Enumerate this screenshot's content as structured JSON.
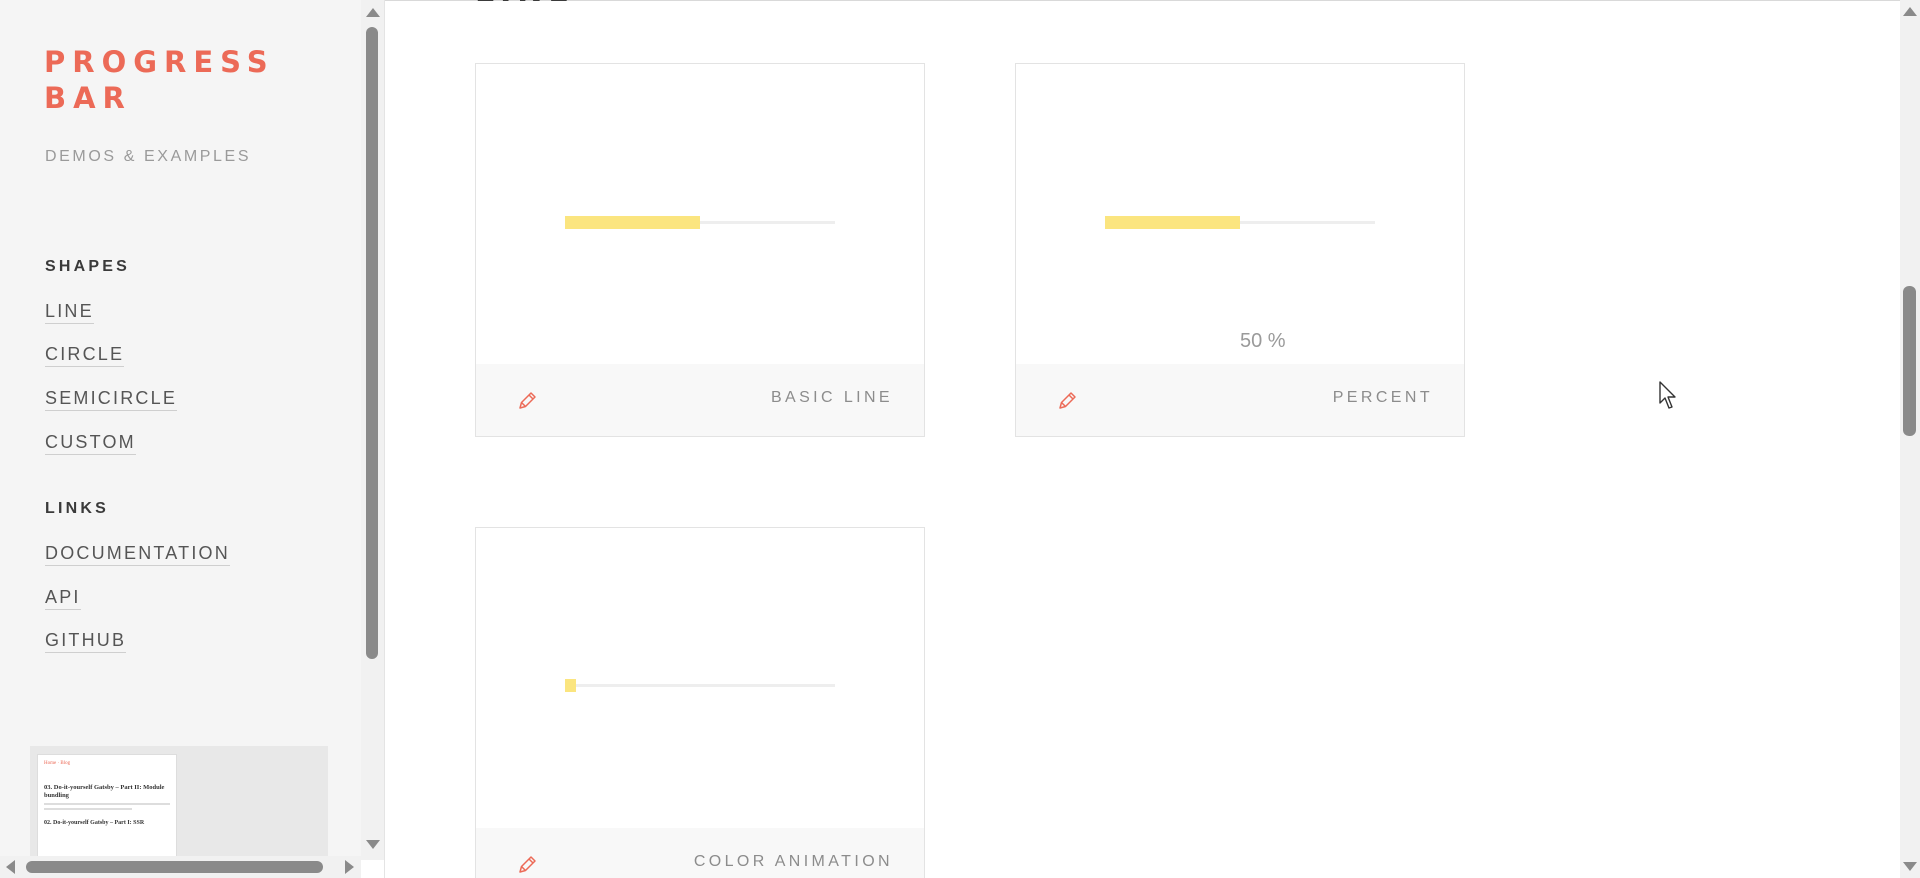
{
  "sidebar": {
    "brand": "PROGRESS BAR",
    "tagline": "DEMOS & EXAMPLES",
    "shapes_heading": "SHAPES",
    "shapes": [
      "LINE",
      "CIRCLE",
      "SEMICIRCLE",
      "CUSTOM"
    ],
    "links_heading": "LINKS",
    "links": [
      "DOCUMENTATION",
      "API",
      "GITHUB"
    ],
    "thumbnail": {
      "nav": "Home · Blog",
      "title1": "03. Do-it-yourself Gatsby – Part II: Module bundling",
      "title2": "02. Do-it-yourself Gatsby – Part I: SSR"
    }
  },
  "main": {
    "section_title": "LINE",
    "cards": [
      {
        "label": "BASIC LINE",
        "progress": 0.5,
        "show_percent": false,
        "percent_text": ""
      },
      {
        "label": "PERCENT",
        "progress": 0.5,
        "show_percent": true,
        "percent_text": "50 %"
      },
      {
        "label": "COLOR ANIMATION",
        "progress": 0.04,
        "show_percent": false,
        "percent_text": ""
      }
    ]
  },
  "icons": {
    "edit": "pencil-icon",
    "cursor": "mouse-pointer-icon"
  },
  "colors": {
    "accent": "#ec6a57",
    "bar_fill": "#fbe57f",
    "bar_track": "#eeeeee",
    "sidebar_bg": "#f5f5f5"
  }
}
